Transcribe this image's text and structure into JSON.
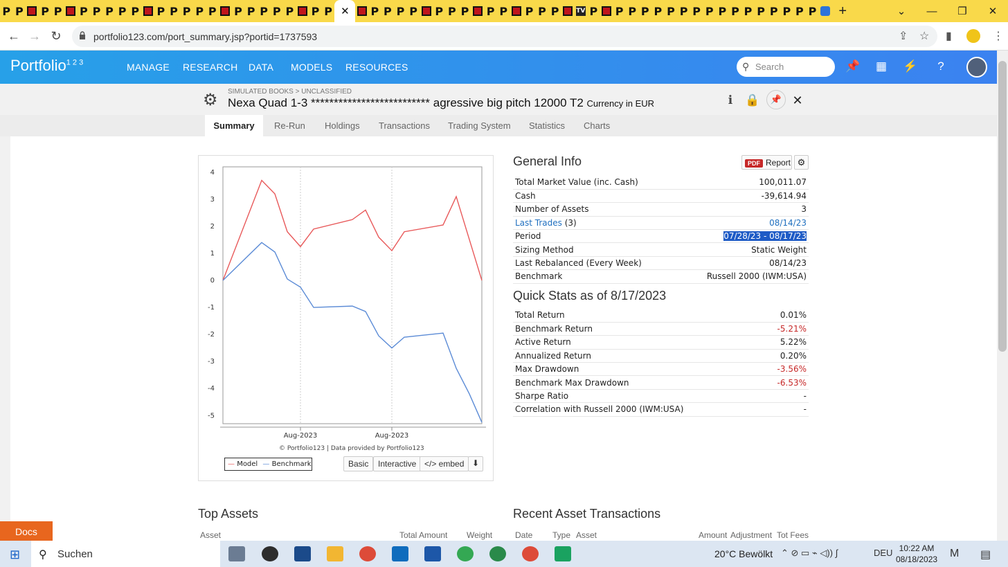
{
  "browser": {
    "active_tab_close": "✕",
    "new_tab": "+",
    "url": "portfolio123.com/port_summary.jsp?portid=1737593"
  },
  "app": {
    "logo": "Portfolio",
    "logo_super": "1 2 3",
    "nav": [
      "MANAGE",
      "RESEARCH",
      "DATA",
      "MODELS",
      "RESOURCES"
    ],
    "search_placeholder": "Search"
  },
  "page": {
    "breadcrumb": "SIMULATED BOOKS > UNCLASSIFIED",
    "title": "Nexa Quad 1-3 ************************** agressive big pitch 12000 T2",
    "currency": "Currency in EUR",
    "tabs": [
      "Summary",
      "Re-Run",
      "Holdings",
      "Transactions",
      "Trading System",
      "Statistics",
      "Charts"
    ],
    "active_tab": "Summary"
  },
  "chart": {
    "credit": "© Portfolio123 | Data provided by Portfolio123",
    "legend_model": "Model",
    "legend_benchmark": "Benchmark",
    "buttons": [
      "Basic",
      "Interactive",
      "</> embed"
    ]
  },
  "chart_data": {
    "type": "line",
    "x_tick_labels": [
      "Aug-2023",
      "Aug-2023"
    ],
    "ylim": [
      -5.3,
      4.2
    ],
    "y_ticks": [
      4,
      3,
      2,
      1,
      0,
      -1,
      -2,
      -3,
      -4,
      -5
    ],
    "grid": true,
    "legend": "bottom-left",
    "series": [
      {
        "name": "Model",
        "color": "#e8595a",
        "values": [
          0,
          3.7,
          3.2,
          1.8,
          1.25,
          1.9,
          2.25,
          2.6,
          1.6,
          1.1,
          1.8,
          2.05,
          3.1,
          0
        ]
      },
      {
        "name": "Benchmark",
        "color": "#5b8bd6",
        "values": [
          0,
          1.4,
          1.05,
          0.05,
          -0.25,
          -1.0,
          -0.95,
          -1.15,
          -2.05,
          -2.5,
          -2.1,
          -1.95,
          -3.25,
          -4.2,
          -5.25
        ]
      }
    ]
  },
  "general_info": {
    "title": "General Info",
    "report_pdf": "PDF",
    "report_label": "Report",
    "rows": [
      {
        "label": "Total Market Value (inc. Cash)",
        "value": "100,011.07"
      },
      {
        "label": "Cash",
        "value": "-39,614.94"
      },
      {
        "label": "Number of Assets",
        "value": "3"
      },
      {
        "label": "Last Trades",
        "label_suffix": "(3)",
        "value": "08/14/23"
      },
      {
        "label": "Period",
        "value": "07/28/23 - 08/17/23"
      },
      {
        "label": "Sizing Method",
        "value": "Static Weight"
      },
      {
        "label": "Last Rebalanced (Every Week)",
        "value": "08/14/23"
      },
      {
        "label": "Benchmark",
        "value": "Russell 2000 (IWM:USA)"
      }
    ]
  },
  "quick_stats": {
    "title": "Quick Stats as of 8/17/2023",
    "rows": [
      {
        "label": "Total Return",
        "value": "0.01%"
      },
      {
        "label": "Benchmark Return",
        "value": "-5.21%"
      },
      {
        "label": "Active Return",
        "value": "5.22%"
      },
      {
        "label": "Annualized Return",
        "value": "0.20%"
      },
      {
        "label": "Max Drawdown",
        "value": "-3.56%"
      },
      {
        "label": "Benchmark Max Drawdown",
        "value": "-6.53%"
      },
      {
        "label": "Sharpe Ratio",
        "value": "-"
      },
      {
        "label": "Correlation with Russell 2000 (IWM:USA)",
        "value": "-"
      }
    ]
  },
  "top_assets": {
    "title": "Top Assets",
    "columns": [
      "Asset",
      "Total Amount",
      "Weight"
    ]
  },
  "recent_tx": {
    "title": "Recent Asset Transactions",
    "columns": [
      "Date",
      "Type",
      "Asset",
      "Amount",
      "Adjustment",
      "Tot Fees"
    ]
  },
  "docs": "Docs",
  "taskbar": {
    "search": "Suchen",
    "weather": "20°C  Bewölkt",
    "lang": "DEU",
    "time": "10:22 AM",
    "date": "08/18/2023"
  }
}
